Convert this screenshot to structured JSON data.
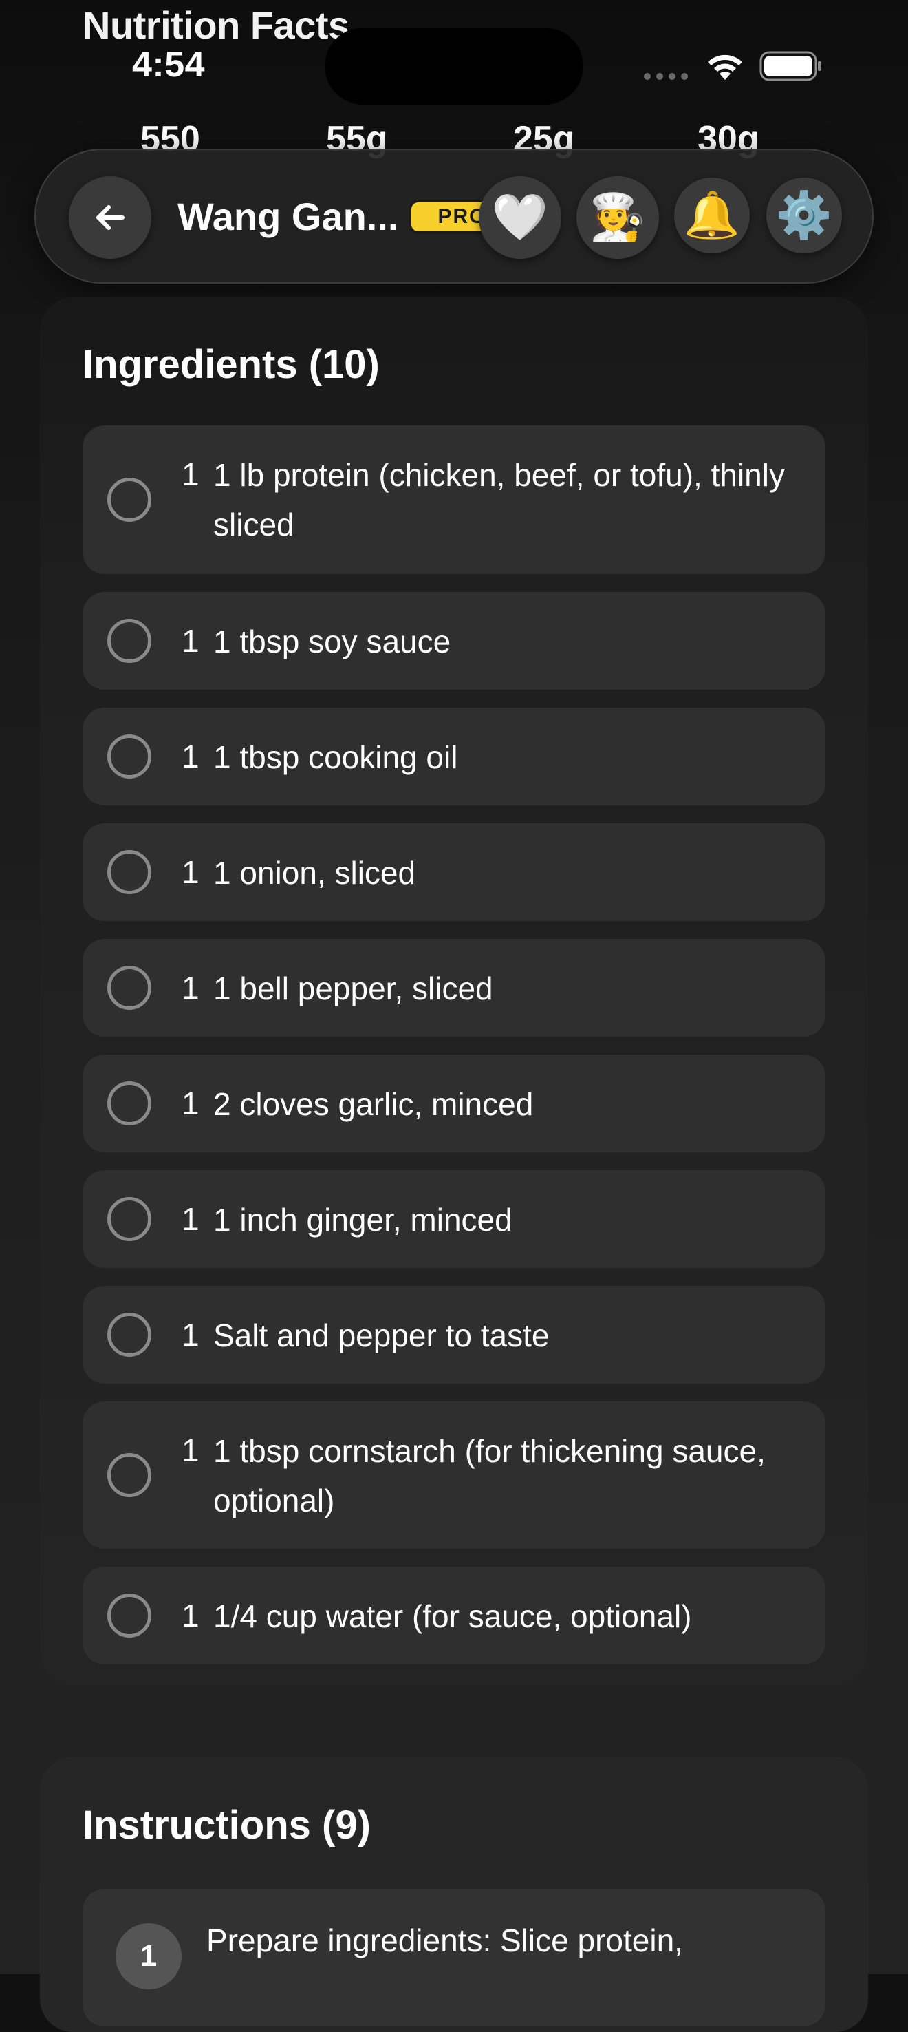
{
  "nutrition": {
    "title": "Nutrition Facts",
    "values": [
      "550",
      "55g",
      "25g",
      "30g"
    ]
  },
  "status_bar": {
    "time": "4:54"
  },
  "nav": {
    "title": "Wang Gan...",
    "badge": "PRO",
    "icons": {
      "back": "arrow-left-icon",
      "favorite": "white-heart-icon",
      "chef": "chef-icon",
      "notifications": "bell-icon",
      "settings": "gear-icon"
    },
    "emoji": {
      "heart": "🤍",
      "chef": "🧑‍🍳",
      "bell": "🔔",
      "gear": "⚙️"
    }
  },
  "ingredients": {
    "title": "Ingredients (10)",
    "items": [
      {
        "qty": "1",
        "text": "1 lb protein (chicken, beef, or tofu), thinly sliced"
      },
      {
        "qty": "1",
        "text": "1 tbsp soy sauce"
      },
      {
        "qty": "1",
        "text": "1 tbsp cooking oil"
      },
      {
        "qty": "1",
        "text": "1 onion, sliced"
      },
      {
        "qty": "1",
        "text": "1 bell pepper, sliced"
      },
      {
        "qty": "1",
        "text": "2 cloves garlic, minced"
      },
      {
        "qty": "1",
        "text": "1 inch ginger, minced"
      },
      {
        "qty": "1",
        "text": "Salt and pepper to taste"
      },
      {
        "qty": "1",
        "text": "1 tbsp cornstarch (for thickening sauce, optional)"
      },
      {
        "qty": "1",
        "text": "1/4 cup water (for sauce, optional)"
      }
    ]
  },
  "instructions": {
    "title": "Instructions (9)",
    "steps": [
      {
        "number": "1",
        "text": "Prepare ingredients: Slice protein,"
      }
    ]
  },
  "colors": {
    "background": "#111111",
    "card": "#2f2f2f",
    "pro_badge": "#f7cf2a",
    "text": "#ffffff"
  }
}
